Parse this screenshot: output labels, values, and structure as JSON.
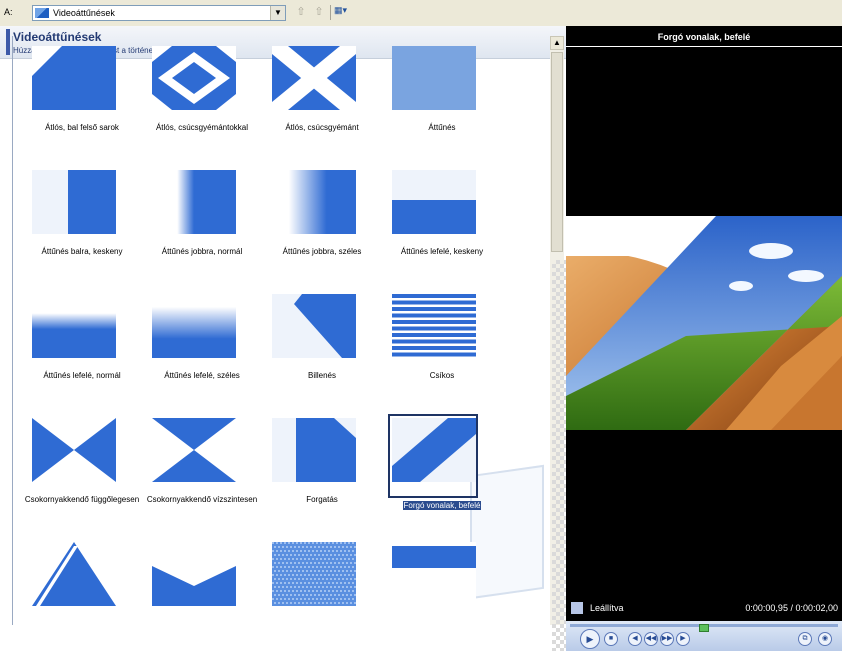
{
  "toolbar": {
    "address_label": "A:",
    "address_value": "Videoáttűnések",
    "dropdown_glyph": "▼",
    "back_glyph": "⇧",
    "forward_glyph": "⇧",
    "view_glyph": "▦▾"
  },
  "panel": {
    "title": "Videoáttűnések",
    "subtitle": "Húzza valamely videoáttűnést a történetfalon két dia közé."
  },
  "transitions": [
    {
      "label": "Átlós, bal felső sarok",
      "icon": "diag-corner-icon"
    },
    {
      "label": "Átlós, csúcsgyémántokkal",
      "icon": "diamond-icon"
    },
    {
      "label": "Átlós, csúcsgyémánt",
      "icon": "cross-icon"
    },
    {
      "label": "Áttűnés",
      "icon": "fade-icon"
    },
    {
      "label": "Áttűnés balra, keskeny",
      "icon": "wipe-left-narrow-icon"
    },
    {
      "label": "Áttűnés jobbra, normál",
      "icon": "wipe-right-normal-icon"
    },
    {
      "label": "Áttűnés jobbra, széles",
      "icon": "wipe-right-wide-icon"
    },
    {
      "label": "Áttűnés lefelé, keskeny",
      "icon": "wipe-down-narrow-icon"
    },
    {
      "label": "Áttűnés lefelé, normál",
      "icon": "wipe-down-normal-icon"
    },
    {
      "label": "Áttűnés lefelé, széles",
      "icon": "wipe-down-wide-icon"
    },
    {
      "label": "Billenés",
      "icon": "tilt-icon"
    },
    {
      "label": "Csíkos",
      "icon": "stripes-icon"
    },
    {
      "label": "Csokornyakkendő függőlegesen",
      "icon": "bowtie-vertical-icon"
    },
    {
      "label": "Csokornyakkendő vízszintesen",
      "icon": "bowtie-horizontal-icon"
    },
    {
      "label": "Forgatás",
      "icon": "rotate-icon"
    },
    {
      "label": "Forgó vonalak, befelé",
      "icon": "rotating-lines-icon"
    },
    {
      "label": "",
      "icon": "chevron-up-icon"
    },
    {
      "label": "",
      "icon": "chevron-down-icon"
    },
    {
      "label": "",
      "icon": "mosaic-icon"
    },
    {
      "label": "",
      "icon": "band-icon"
    }
  ],
  "selected_index": 15,
  "preview": {
    "title": "Forgó vonalak, befelé",
    "status": "Leállítva",
    "time": "0:00:00,95 / 0:00:02,00",
    "seek_fraction": 0.5
  },
  "colors": {
    "accent": "#2f6bd3",
    "header": "#233a73"
  }
}
